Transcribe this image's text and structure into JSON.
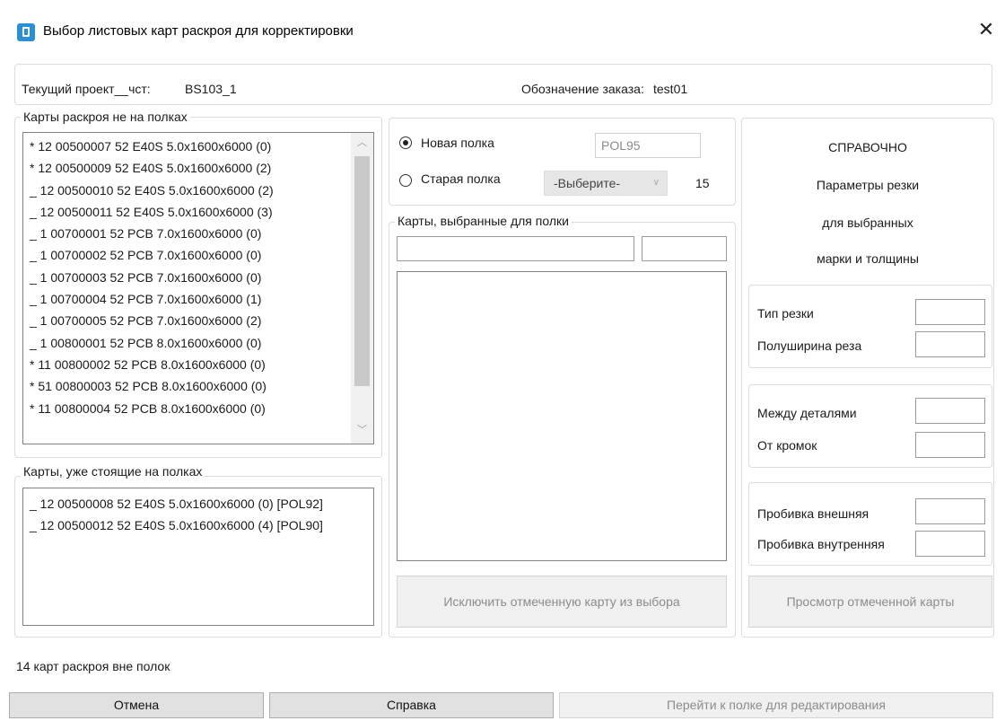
{
  "window": {
    "title": "Выбор листовых карт раскроя для корректировки",
    "close_glyph": "✕"
  },
  "header": {
    "project_label": "Текущий проект__чст:",
    "project_value": "BS103_1",
    "order_label": "Обозначение заказа:",
    "order_value": "test01"
  },
  "unshelved": {
    "legend": "Карты раскроя не на полках",
    "items": [
      "* 12 00500007 52 E40S 5.0x1600x6000 (0)",
      "* 12 00500009 52 E40S 5.0x1600x6000 (2)",
      "_ 12 00500010 52 E40S 5.0x1600x6000 (2)",
      "_ 12 00500011 52 E40S 5.0x1600x6000 (3)",
      "_ 1 00700001 52 PCB 7.0x1600x6000 (0)",
      "_ 1 00700002 52 PCB 7.0x1600x6000 (0)",
      "_ 1 00700003 52 PCB 7.0x1600x6000 (0)",
      "_ 1 00700004 52 PCB 7.0x1600x6000 (1)",
      "_ 1 00700005 52 PCB 7.0x1600x6000 (2)",
      "_ 1 00800001 52 PCB 8.0x1600x6000 (0)",
      "* 11 00800002 52 PCB 8.0x1600x6000 (0)",
      "* 51 00800003 52 PCB 8.0x1600x6000 (0)",
      "* 11 00800004 52 PCB 8.0x1600x6000 (0)"
    ]
  },
  "shelved": {
    "legend": "Карты, уже стоящие на полках",
    "items": [
      "_ 12 00500008 52 E40S 5.0x1600x6000 (0) [POL92]",
      "_ 12 00500012 52 E40S 5.0x1600x6000 (4) [POL90]"
    ]
  },
  "shelf": {
    "new_label": "Новая полка",
    "new_value": "POL95",
    "old_label": "Старая полка",
    "old_select": "-Выберите-",
    "old_count": "15",
    "selected_legend": "Карты, выбранные для полки",
    "filter1": "",
    "filter2": "",
    "exclude_button": "Исключить отмеченную карту из выбора"
  },
  "reference": {
    "title": "СПРАВОЧНО",
    "line1": "Параметры резки",
    "line2": "для выбранных",
    "line3": "марки и толщины",
    "cut_type": "Тип резки",
    "kerf_half": "Полуширина реза",
    "between_parts": "Между деталями",
    "from_edges": "От кромок",
    "pierce_outer": "Пробивка внешняя",
    "pierce_inner": "Пробивка внутренняя",
    "view_button": "Просмотр отмеченной карты"
  },
  "status": {
    "text": "14 карт раскроя вне полок"
  },
  "footer": {
    "cancel": "Отмена",
    "help": "Справка",
    "goto_shelf": "Перейти к полке для редактирования"
  }
}
